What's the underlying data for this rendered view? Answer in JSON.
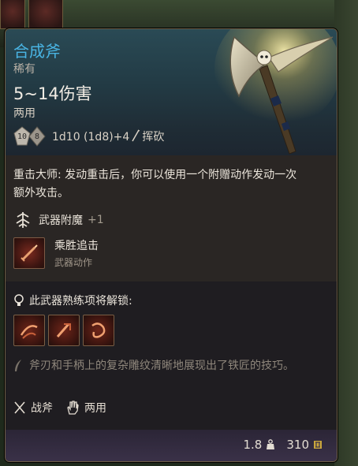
{
  "item": {
    "name": "合成斧",
    "rarity": "稀有",
    "damage": "5~14伤害",
    "handedness": "两用",
    "dice": {
      "die1": "10",
      "die2": "8",
      "formula": "1d10 (1d8)+4",
      "damage_type": "挥砍",
      "damage_type_icon": "slashing-icon"
    },
    "passive_text": "重击大师: 发动重击后，你可以使用一个附赠动作发动一次额外攻击。",
    "enchantment": {
      "label": "武器附魔",
      "value": "+1",
      "icon": "enchant-icon"
    },
    "action": {
      "name": "乘胜追击",
      "type": "武器动作",
      "icon": "sword-action-icon"
    },
    "proficiency_title": "此武器熟练项将解锁:",
    "proficiency_icons": [
      "slash-skill-icon",
      "cleave-skill-icon",
      "flourish-skill-icon"
    ],
    "lore": "斧刃和手柄上的复杂雕纹清晰地展现出了铁匠的技巧。",
    "tags": [
      {
        "label": "战斧",
        "icon": "crossed-axes-icon"
      },
      {
        "label": "两用",
        "icon": "hand-icon"
      }
    ],
    "weight": "1.8",
    "weight_icon": "weight-icon",
    "price": "310",
    "price_icon": "gold-icon"
  },
  "colors": {
    "title": "#49b4e3",
    "header_bg": "#2a4a55",
    "footer_bg": "#3a3148",
    "enchant_value": "#a29a8e"
  }
}
